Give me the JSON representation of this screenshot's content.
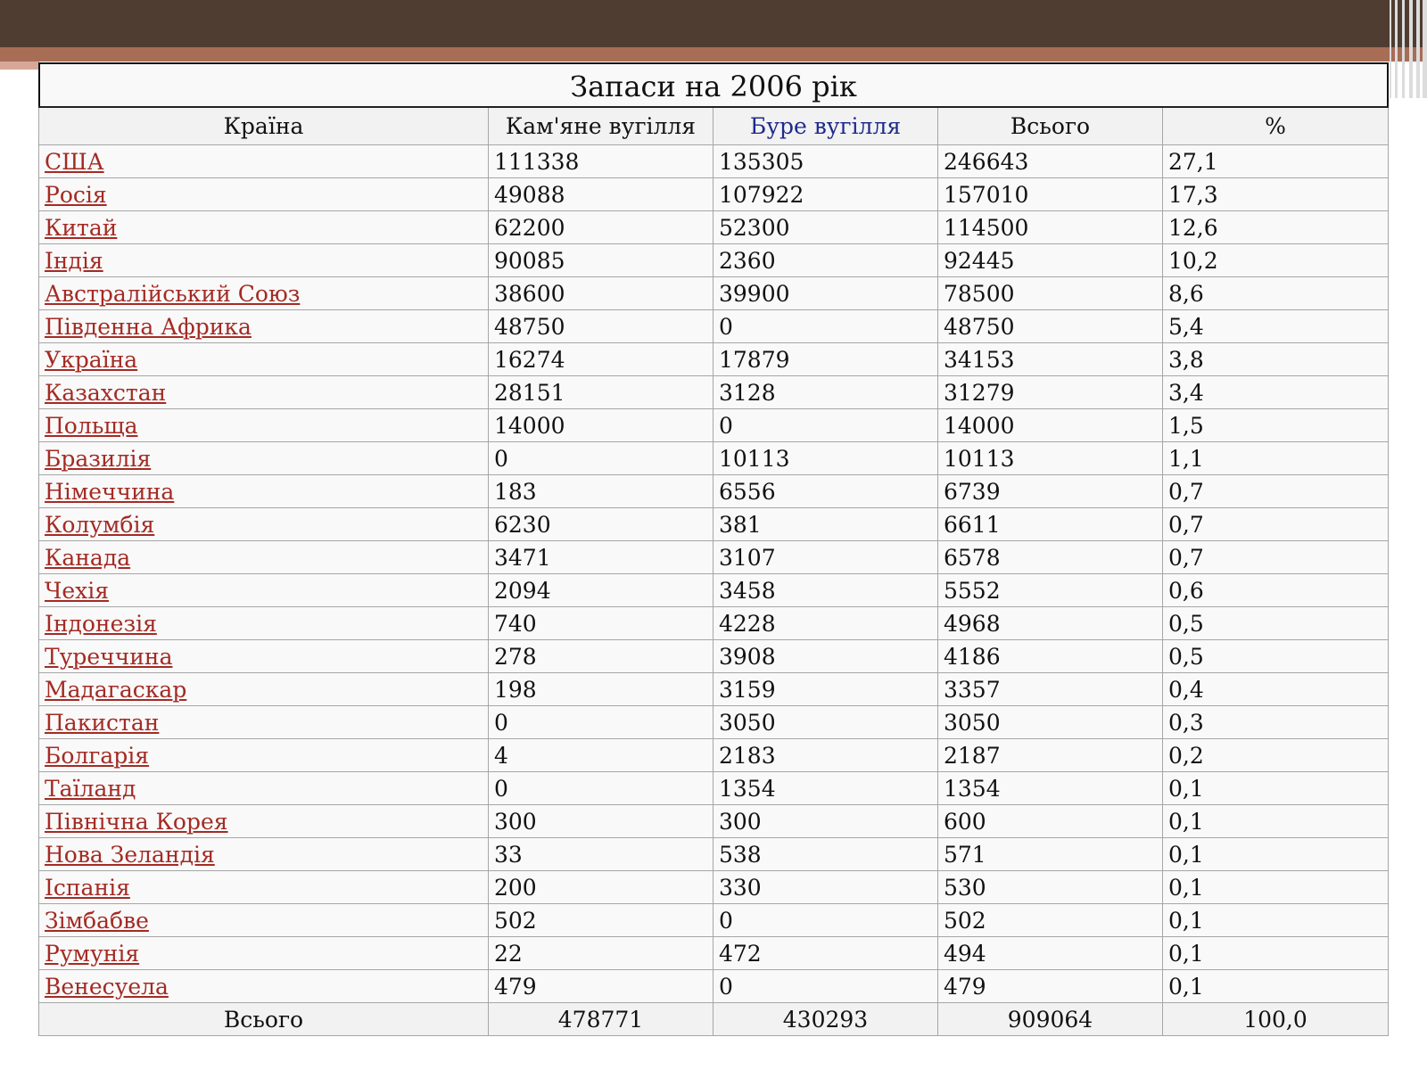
{
  "table": {
    "title": "Запаси на 2006 рік",
    "headers": [
      "Країна",
      "Кам'яне вугілля",
      "Буре вугілля",
      "Всього",
      "%"
    ],
    "rows": [
      [
        "США",
        "111338",
        "135305",
        "246643",
        "27,1"
      ],
      [
        "Росія",
        "49088",
        "107922",
        "157010",
        "17,3"
      ],
      [
        "Китай",
        "62200",
        "52300",
        "114500",
        "12,6"
      ],
      [
        "Індія",
        "90085",
        "2360",
        "92445",
        "10,2"
      ],
      [
        "Австралійський Союз",
        "38600",
        "39900",
        "78500",
        "8,6"
      ],
      [
        "Південна Африка",
        "48750",
        "0",
        "48750",
        "5,4"
      ],
      [
        "Україна",
        "16274",
        "17879",
        "34153",
        "3,8"
      ],
      [
        "Казахстан",
        "28151",
        "3128",
        "31279",
        "3,4"
      ],
      [
        "Польща",
        "14000",
        "0",
        "14000",
        "1,5"
      ],
      [
        "Бразилія",
        "0",
        "10113",
        "10113",
        "1,1"
      ],
      [
        "Німеччина",
        "183",
        "6556",
        "6739",
        "0,7"
      ],
      [
        "Колумбія",
        "6230",
        "381",
        "6611",
        "0,7"
      ],
      [
        "Канада",
        "3471",
        "3107",
        "6578",
        "0,7"
      ],
      [
        "Чехія",
        "2094",
        "3458",
        "5552",
        "0,6"
      ],
      [
        "Індонезія",
        "740",
        "4228",
        "4968",
        "0,5"
      ],
      [
        "Туреччина",
        "278",
        "3908",
        "4186",
        "0,5"
      ],
      [
        "Мадагаскар",
        "198",
        "3159",
        "3357",
        "0,4"
      ],
      [
        "Пакистан",
        "0",
        "3050",
        "3050",
        "0,3"
      ],
      [
        "Болгарія",
        "4",
        "2183",
        "2187",
        "0,2"
      ],
      [
        "Таїланд",
        "0",
        "1354",
        "1354",
        "0,1"
      ],
      [
        "Північна Корея",
        "300",
        "300",
        "600",
        "0,1"
      ],
      [
        "Нова Зеландія",
        "33",
        "538",
        "571",
        "0,1"
      ],
      [
        "Іспанія",
        "200",
        "330",
        "530",
        "0,1"
      ],
      [
        "Зімбабве",
        "502",
        "0",
        "502",
        "0,1"
      ],
      [
        "Румунія",
        "22",
        "472",
        "494",
        "0,1"
      ],
      [
        "Венесуела",
        "479",
        "0",
        "479",
        "0,1"
      ]
    ],
    "total_row": [
      "Всього",
      "478771",
      "430293",
      "909064",
      "100,0"
    ]
  },
  "colors": {
    "top_bar": "#4f3d31",
    "accent_stripe": "#a86d55",
    "link": "#a32b24",
    "blue_header": "#1f2a8c"
  }
}
